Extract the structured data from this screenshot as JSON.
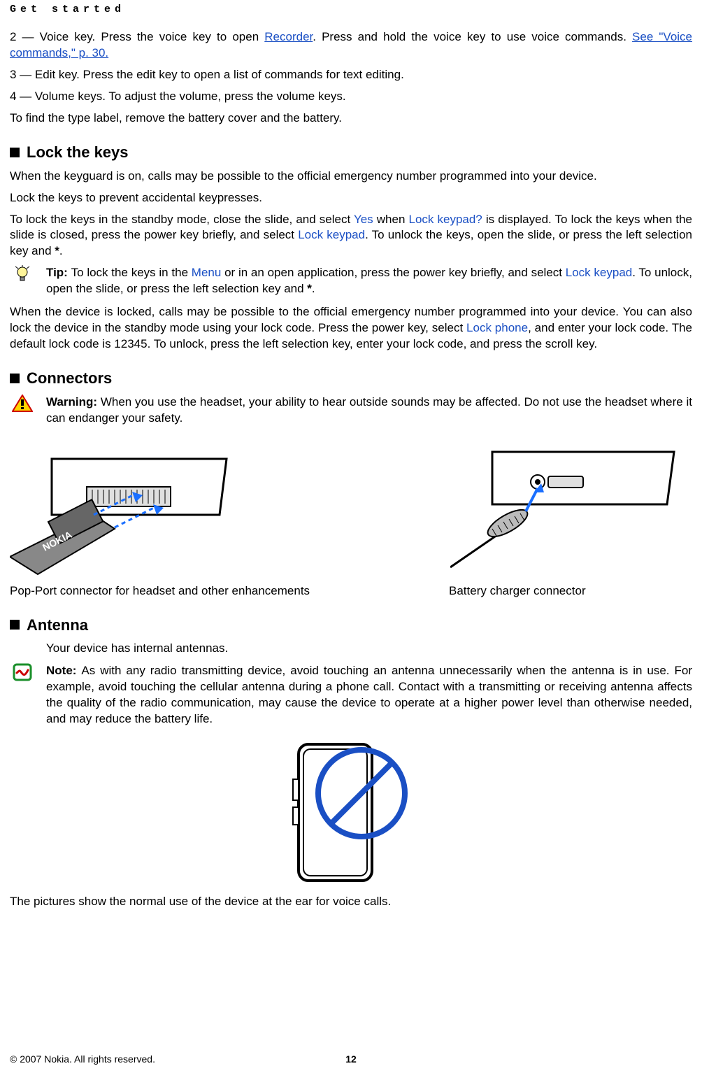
{
  "header": "Get started",
  "intro": {
    "p1_before": "2 — Voice key. Press the voice key to open ",
    "p1_link1": "Recorder",
    "p1_mid": ". Press and hold the voice key to use voice commands. ",
    "p1_link2": "See \"Voice commands,\" p. 30.",
    "p2": "3 — Edit key. Press the edit key to open a list of commands for text editing.",
    "p3": "4 — Volume keys. To adjust the volume, press the volume keys.",
    "p4": "To find the type label, remove the battery cover and the battery."
  },
  "lock": {
    "title": "Lock the keys",
    "p1": "When the keyguard is on, calls may be possible to the official emergency number programmed into your device.",
    "p2": "Lock the keys to prevent accidental keypresses.",
    "p3_a": "To lock the keys in the standby mode, close the slide, and select ",
    "p3_yes": "Yes",
    "p3_b": " when ",
    "p3_lkq": "Lock keypad?",
    "p3_c": " is displayed. To lock the keys when the slide is closed, press the power key briefly, and select ",
    "p3_lk": "Lock keypad",
    "p3_d": ". To unlock the keys, open the slide, or press the left selection key and ",
    "p3_star1": "*",
    "p3_e": ".",
    "tip_label": "Tip: ",
    "tip_a": "To lock the keys in the ",
    "tip_menu": "Menu",
    "tip_b": " or in an open application, press the power key briefly, and select ",
    "tip_lk": "Lock keypad",
    "tip_c": ". To unlock, open the slide, or press the left selection key and ",
    "tip_star": "*",
    "tip_d": ".",
    "p4_a": "When the device is locked, calls may be possible to the official emergency number programmed into your device. You can also lock the device in the standby mode using your lock code. Press the power key, select ",
    "p4_lp": "Lock phone",
    "p4_b": ", and enter your lock code. The default lock code is 12345. To unlock, press the left selection key, enter your lock code, and press the scroll key."
  },
  "connectors": {
    "title": "Connectors",
    "warn_label": "Warning:  ",
    "warn_text": "When you use the headset, your ability to hear outside sounds may be affected. Do not use the headset where it can endanger your safety.",
    "caption_left": "Pop-Port connector for headset and other enhancements",
    "caption_right": "Battery charger connector"
  },
  "antenna": {
    "title": "Antenna",
    "p1": "Your device has internal antennas.",
    "note_label": "Note:  ",
    "note_text": "As with any radio transmitting device, avoid touching an antenna unnecessarily when the antenna is in use. For example, avoid touching the cellular antenna during a phone call. Contact with a transmitting or receiving antenna affects the quality of the radio communication, may cause the device to operate at a higher power level than otherwise needed, and may reduce the battery life.",
    "p2": "The pictures show the normal use of the device at the ear for voice calls."
  },
  "footer": {
    "copyright": "© 2007 Nokia. All rights reserved.",
    "page": "12"
  }
}
